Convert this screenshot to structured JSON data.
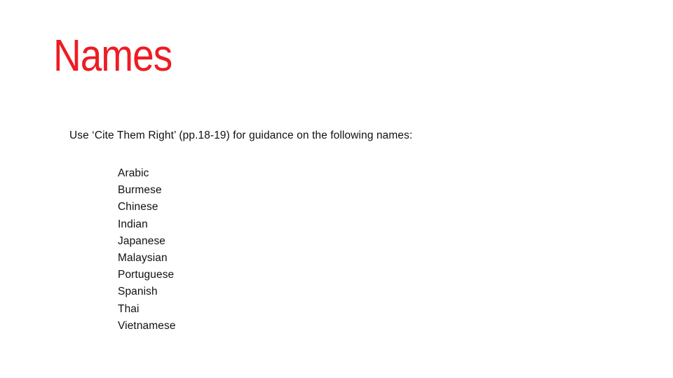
{
  "slide": {
    "title": "Names",
    "title_color": "#ED1C24",
    "background_color": "#FFFFFF",
    "body_color": "#111111",
    "intro": "Use ‘Cite Them Right’ (pp.18-19) for guidance on the following names:",
    "names": [
      "Arabic",
      "Burmese",
      "Chinese",
      "Indian",
      "Japanese",
      "Malaysian",
      "Portuguese",
      "Spanish",
      "Thai",
      "Vietnamese"
    ]
  }
}
